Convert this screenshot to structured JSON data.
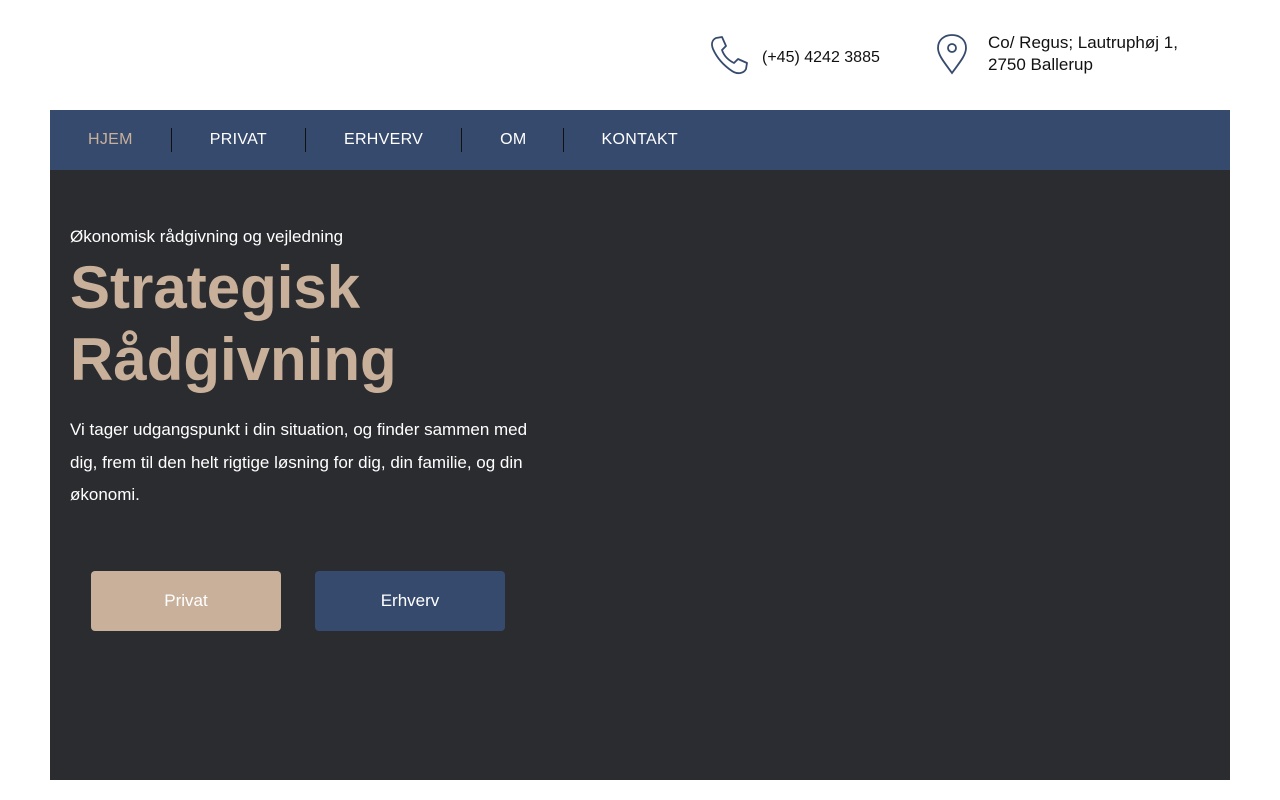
{
  "header": {
    "phone": "(+45) 4242 3885",
    "address_line1": "Co/ Regus; Lautruphøj 1,",
    "address_line2": "2750 Ballerup",
    "icons": [
      "phone-icon",
      "location-pin-icon"
    ],
    "icon_color": "#364a6d"
  },
  "nav": {
    "items": [
      {
        "label": "HJEM",
        "active": true
      },
      {
        "label": "PRIVAT",
        "active": false
      },
      {
        "label": "ERHVERV",
        "active": false
      },
      {
        "label": "OM",
        "active": false
      },
      {
        "label": "KONTAKT",
        "active": false
      }
    ],
    "background": "#364a6d",
    "active_color": "#c8b09a"
  },
  "hero": {
    "eyebrow": "Økonomisk rådgivning og vejledning",
    "title_line1": "Strategisk",
    "title_line2": "Rådgivning",
    "description": "Vi tager udgangspunkt i din situation, og finder sammen med dig, frem til den helt rigtige løsning for dig, din familie, og din økonomi.",
    "background": "#2b2c30",
    "accent": "#c8b09a",
    "buttons": {
      "privat": "Privat",
      "erhverv": "Erhverv"
    }
  }
}
